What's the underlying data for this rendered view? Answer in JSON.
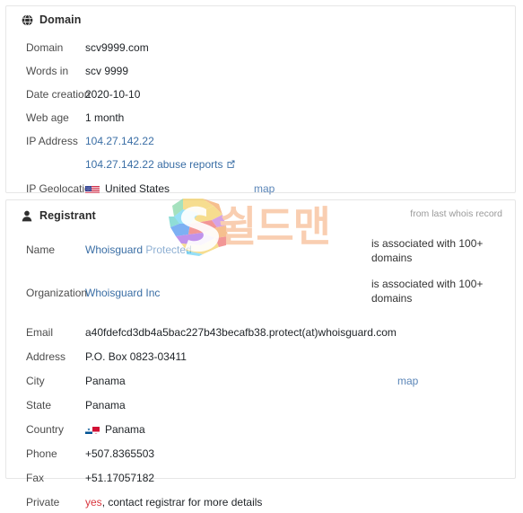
{
  "domain_card": {
    "title": "Domain",
    "icon": "globe-icon",
    "rows": [
      {
        "label": "Domain",
        "value": "scv9999.com"
      },
      {
        "label": "Words in",
        "value": "scv 9999"
      },
      {
        "label": "Date creation",
        "value": "2020-10-10"
      },
      {
        "label": "Web age",
        "value": "1 month"
      },
      {
        "label": "IP Address",
        "value": "104.27.142.22"
      }
    ],
    "abuse_link": "104.27.142.22 abuse reports",
    "abuse_link_icon": "external-link-icon",
    "geolocation": {
      "label": "IP Geolocation",
      "country": "United States",
      "flag": "flag-us",
      "map_link": "map"
    }
  },
  "registrant_card": {
    "title": "Registrant",
    "icon": "user-icon",
    "header_note": "from last whois record",
    "name": {
      "label": "Name",
      "value_link": "Whoisguard",
      "value_muted": "Protected",
      "note": "is associated with 100+ domains"
    },
    "organization": {
      "label": "Organization",
      "value_link": "Whoisguard Inc",
      "note": "is associated with 100+ domains"
    },
    "rows": [
      {
        "label": "Email",
        "value": "a40fdefcd3db4a5bac227b43becafb38.protect(at)whoisguard.com"
      },
      {
        "label": "Address",
        "value": "P.O. Box 0823-03411"
      }
    ],
    "city": {
      "label": "City",
      "value": "Panama",
      "map_link": "map"
    },
    "state": {
      "label": "State",
      "value": "Panama"
    },
    "country": {
      "label": "Country",
      "value": "Panama",
      "flag": "flag-pa"
    },
    "phone": {
      "label": "Phone",
      "value": "+507.8365503"
    },
    "fax": {
      "label": "Fax",
      "value": "+51.17057182"
    },
    "private": {
      "label": "Private",
      "value_flag": "yes",
      "value_rest": ", contact registrar for more details"
    }
  },
  "watermark": {
    "text": "쉴드맨",
    "logo": "shieldman-s-logo"
  },
  "colors": {
    "link": "#3a6ea5",
    "link_muted": "#8fb0d3",
    "danger": "#d9363e",
    "label": "#4c4c4c",
    "card_border": "#e6e6e6",
    "watermark": "#f6b183"
  }
}
